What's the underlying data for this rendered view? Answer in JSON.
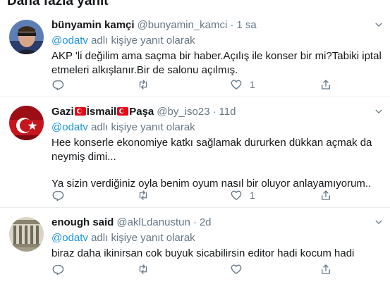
{
  "section": {
    "title": "Daha fazla yanıt"
  },
  "reply_prefix": "adlı kişiye yanıt olarak",
  "tweets": [
    {
      "name": "bünyamin kamçi",
      "handle": "@bunyamin_kamci",
      "time": "1 sa",
      "reply_mention": "@odatv",
      "text_lines": [
        "AKP 'li değilim ama saçma bir haber.Açılış ile konser bir mi?Tabiki iptal etmeleri alkışlanır.Bir de salonu açılmış."
      ],
      "likes": "1",
      "replies": "",
      "retweets": ""
    },
    {
      "name_parts": [
        "Gazi",
        "İsmail",
        "Paşa"
      ],
      "handle": "@by_iso23",
      "time": "11d",
      "reply_mention": "@odatv",
      "text_lines": [
        "Hee konserle ekonomiye katkı sağlamak dururken dükkan açmak da neymiş dimi...",
        "Ya sizin verdiğiniz oyla benim oyum nasıl bir oluyor anlayamıyorum.."
      ],
      "likes": "1",
      "replies": "",
      "retweets": ""
    },
    {
      "name": "enough said",
      "handle": "@aklLdanustun",
      "time": "2d",
      "reply_mention": "@odatv",
      "text_lines": [
        "biraz daha ikinirsan cok buyuk sicabilirsin editor hadi kocum hadi"
      ],
      "likes": "",
      "replies": "",
      "retweets": ""
    }
  ],
  "colors": {
    "text": "#14171a",
    "secondary": "#657786",
    "link": "#1b95e0",
    "divider": "#e6ecf0",
    "flag_red": "#e30a17"
  },
  "icons": {
    "reply": "reply-icon",
    "retweet": "retweet-icon",
    "like": "like-icon",
    "share": "share-icon",
    "more": "chevron-down-icon"
  }
}
